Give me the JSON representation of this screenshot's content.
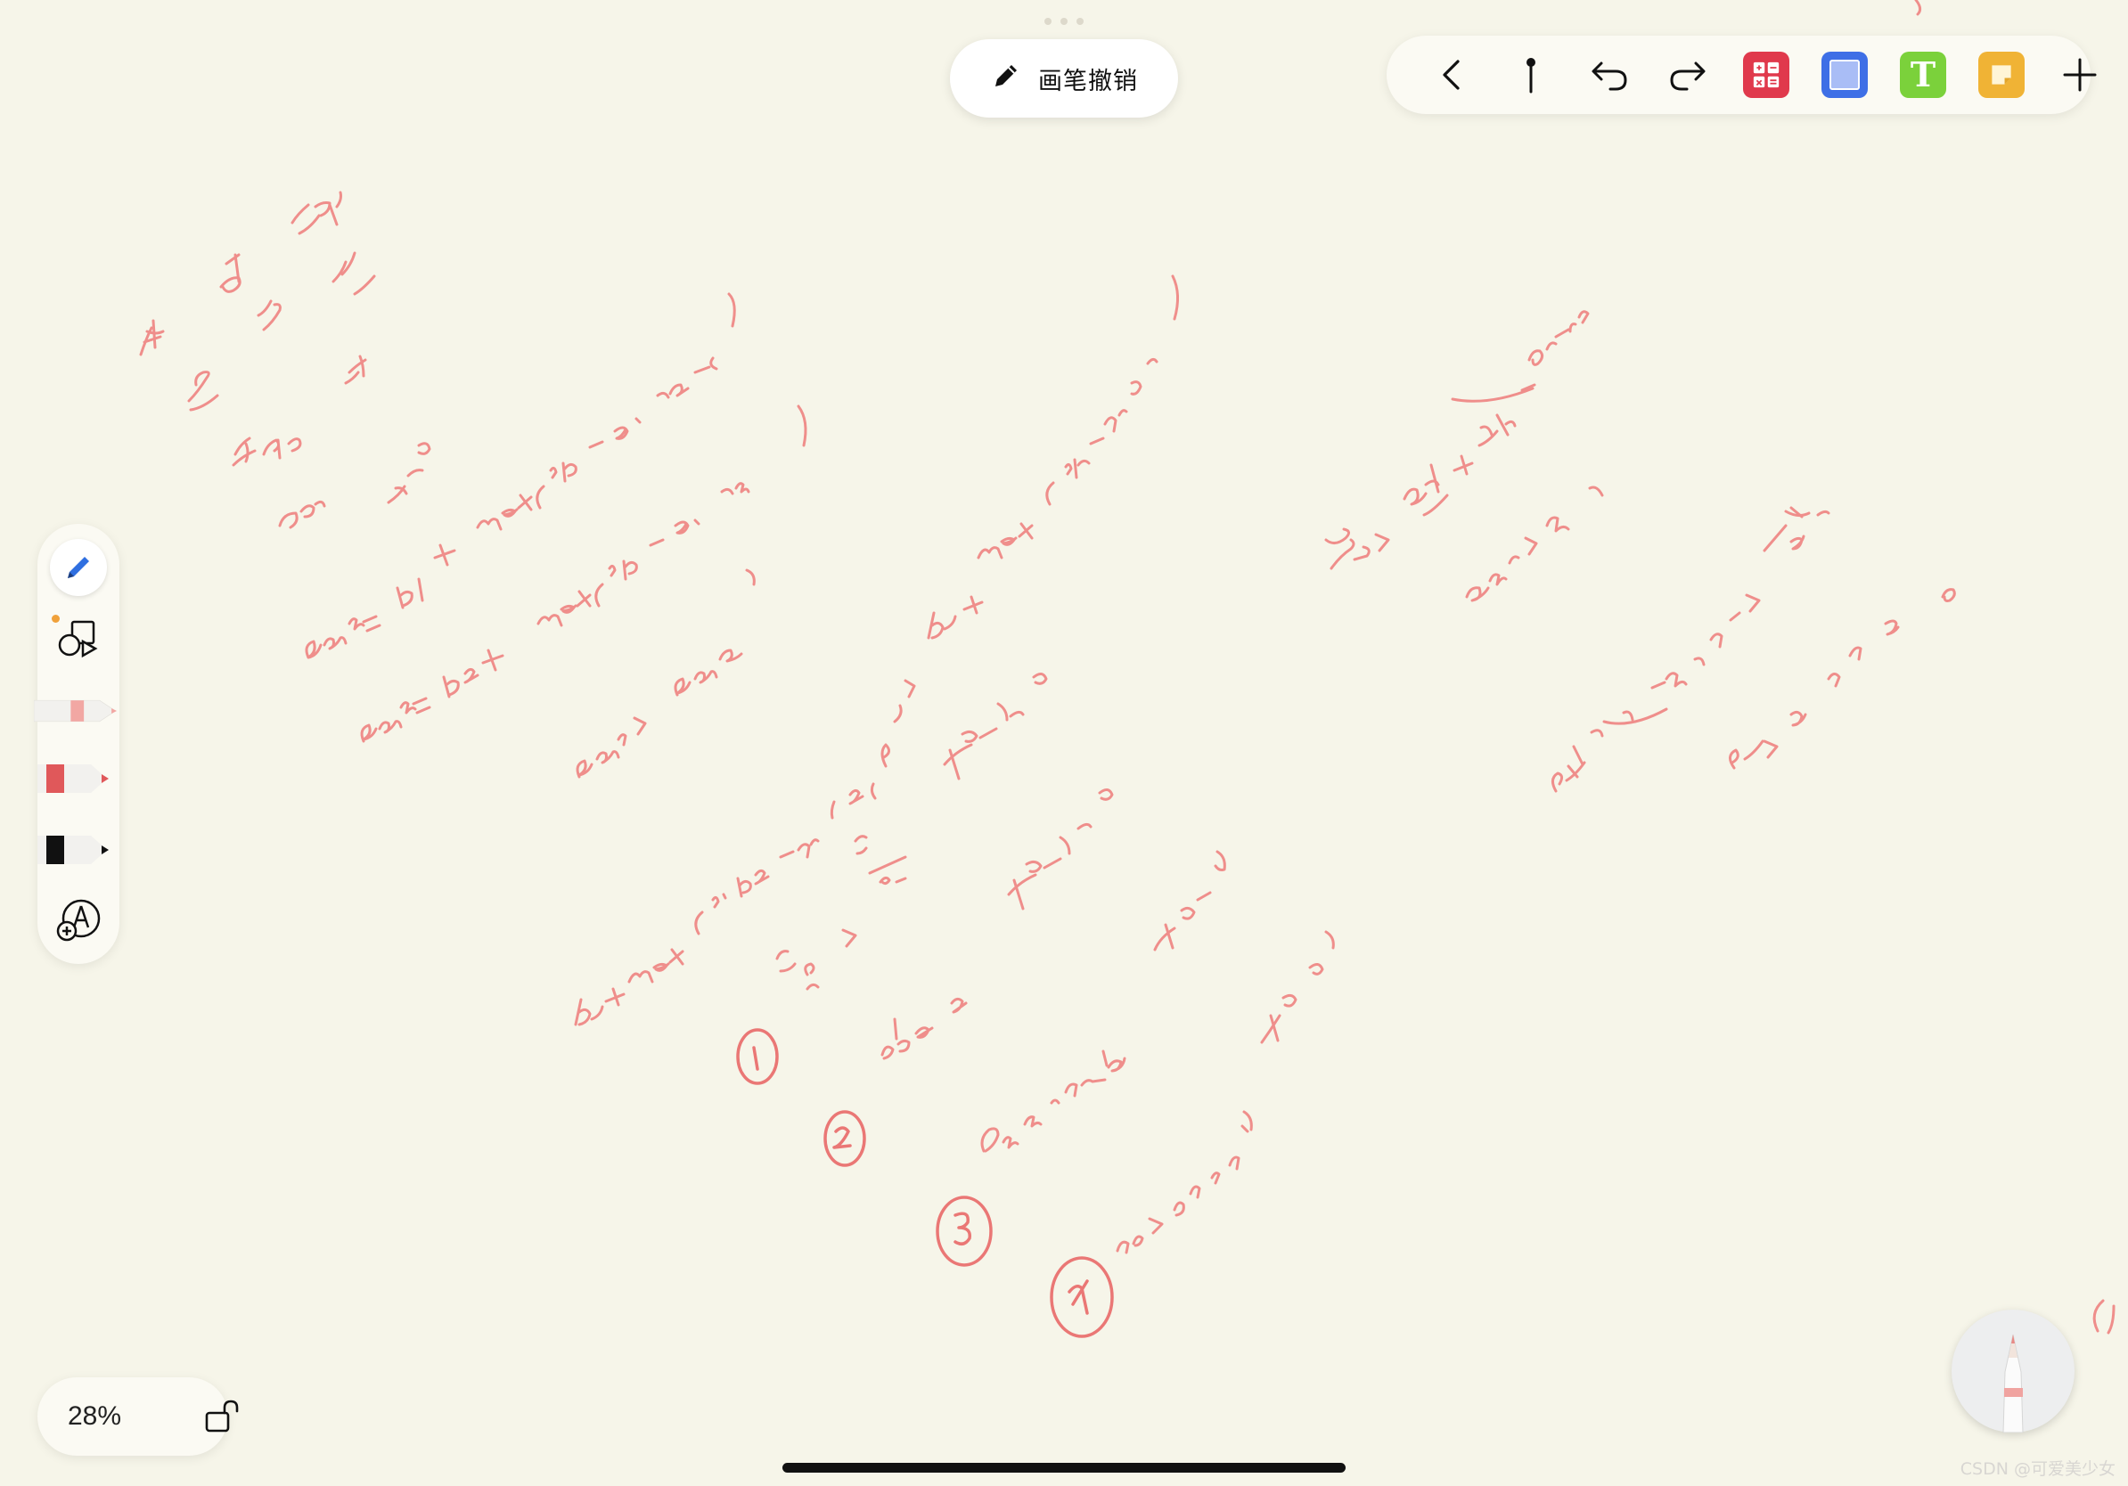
{
  "app": {
    "undo_pill": {
      "label": "画笔撤销",
      "icon": "pencil-icon"
    },
    "zoom": {
      "level": "28%",
      "lock_icon": "unlock-icon"
    },
    "watermark": "CSDN @可爱美少女",
    "top_toolbar": {
      "buttons": [
        {
          "name": "back-button",
          "icon": "chevron-left-icon"
        },
        {
          "name": "pin-button",
          "icon": "pin-icon"
        },
        {
          "name": "undo-button",
          "icon": "undo-arrow-icon"
        },
        {
          "name": "redo-button",
          "icon": "redo-arrow-icon"
        },
        {
          "name": "calculator-button",
          "icon": "calculator-icon",
          "color": "#e0394c"
        },
        {
          "name": "shape-button",
          "icon": "square-icon",
          "color": "#3e6fe6"
        },
        {
          "name": "text-button",
          "icon": "text-icon",
          "label": "T",
          "color": "#7bd13b"
        },
        {
          "name": "sticky-note-button",
          "icon": "sticky-note-icon",
          "color": "#f0b335"
        },
        {
          "name": "add-button",
          "icon": "plus-icon"
        }
      ]
    },
    "side_toolbar": {
      "tools": [
        {
          "name": "pen-tool",
          "icon": "pen-icon",
          "selected": true
        },
        {
          "name": "shapes-tool",
          "icon": "shapes-icon"
        },
        {
          "name": "highlighter-pink",
          "icon": "marker-icon",
          "color": "#f2a7a3",
          "selected": true
        },
        {
          "name": "marker-red",
          "icon": "marker-icon",
          "color": "#e0585a"
        },
        {
          "name": "marker-black",
          "icon": "marker-icon",
          "color": "#111111"
        },
        {
          "name": "add-tool",
          "icon": "add-tool-icon"
        }
      ]
    },
    "pencil_button": {
      "icon": "apple-pencil-icon"
    },
    "ink": {
      "color": "#ef8e8b",
      "circle_color": "#ea7775"
    }
  }
}
